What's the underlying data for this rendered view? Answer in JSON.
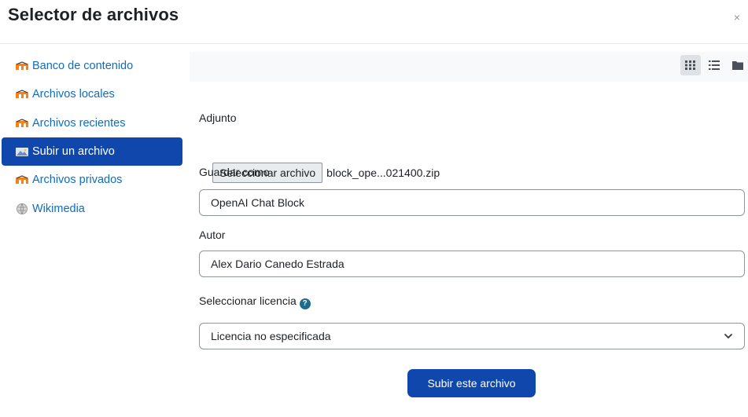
{
  "dialog": {
    "title": "Selector de archivos",
    "close_glyph": "×"
  },
  "sidebar": {
    "items": [
      {
        "label": "Banco de contenido",
        "icon": "moodle-icon",
        "active": false
      },
      {
        "label": "Archivos locales",
        "icon": "moodle-icon",
        "active": false
      },
      {
        "label": "Archivos recientes",
        "icon": "moodle-icon",
        "active": false
      },
      {
        "label": "Subir un archivo",
        "icon": "upload-icon",
        "active": true
      },
      {
        "label": "Archivos privados",
        "icon": "moodle-icon",
        "active": false
      },
      {
        "label": "Wikimedia",
        "icon": "wikimedia-icon",
        "active": false
      }
    ]
  },
  "toolbar": {
    "views": [
      {
        "name": "icons-view",
        "icon": "grid-icon",
        "active": true
      },
      {
        "name": "list-view",
        "icon": "list-icon",
        "active": false
      },
      {
        "name": "tree-view",
        "icon": "folder-icon",
        "active": false
      }
    ]
  },
  "form": {
    "attachment_label": "Adjunto",
    "choose_file_button": "Seleccionar archivo",
    "chosen_file_name": "block_ope...021400.zip",
    "save_as_label": "Guardar como",
    "save_as_value": "OpenAI Chat Block",
    "author_label": "Autor",
    "author_value": "Alex Dario Canedo Estrada",
    "license_label": "Seleccionar licencia",
    "license_value": "Licencia no especificada",
    "submit_button": "Subir este archivo"
  },
  "colors": {
    "accent": "#0f47ad",
    "link": "#0f6cbf",
    "moodle_orange": "#f98012",
    "help": "#1f6b8f"
  }
}
